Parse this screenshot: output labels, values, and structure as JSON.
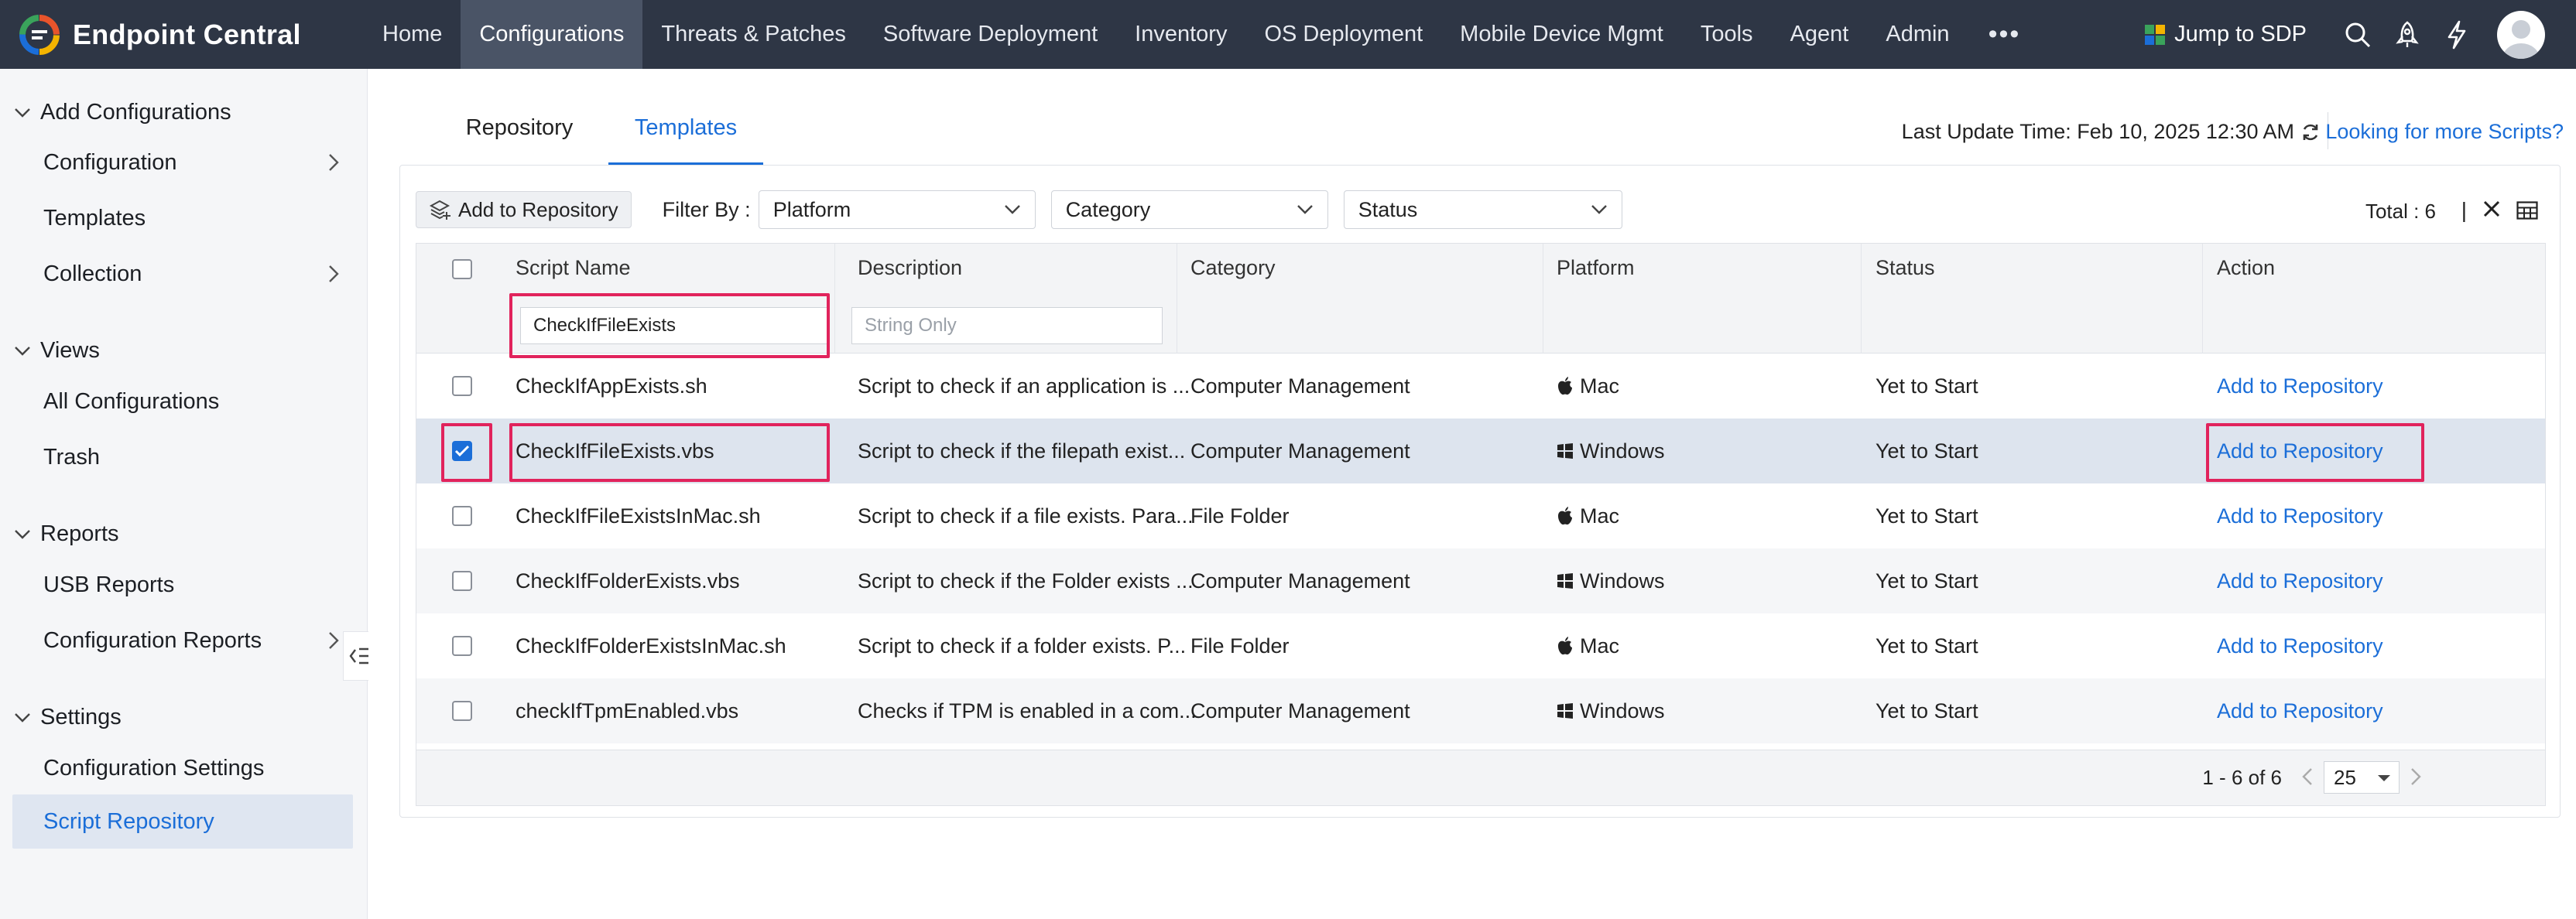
{
  "brand": {
    "name": "Endpoint Central"
  },
  "nav": {
    "items": [
      "Home",
      "Configurations",
      "Threats & Patches",
      "Software Deployment",
      "Inventory",
      "OS Deployment",
      "Mobile Device Mgmt",
      "Tools",
      "Agent",
      "Admin"
    ],
    "active": "Configurations",
    "more": "•••",
    "jump": "Jump to SDP"
  },
  "sidebar": {
    "add_configurations": "Add Configurations",
    "configuration": "Configuration",
    "templates": "Templates",
    "collection": "Collection",
    "views": "Views",
    "all_configurations": "All Configurations",
    "trash": "Trash",
    "reports": "Reports",
    "usb_reports": "USB Reports",
    "configuration_reports": "Configuration Reports",
    "settings": "Settings",
    "configuration_settings": "Configuration Settings",
    "script_repository": "Script Repository"
  },
  "tabs": {
    "repository": "Repository",
    "templates": "Templates",
    "active": "Templates"
  },
  "last_update": "Last Update Time: Feb 10, 2025 12:30 AM",
  "more_scripts": "Looking for more Scripts?",
  "toolbar": {
    "add_to_repository": "Add to Repository",
    "filter_by": "Filter By :",
    "platform": "Platform",
    "category": "Category",
    "status": "Status",
    "total": "Total : 6",
    "separator": "|"
  },
  "table": {
    "columns": [
      "Script Name",
      "Description",
      "Category",
      "Platform",
      "Status",
      "Action"
    ],
    "script_filter_value": "CheckIfFileExists",
    "description_placeholder": "String Only",
    "rows": [
      {
        "name": "CheckIfAppExists.sh",
        "description": "Script to check if an application is ...",
        "category": "Computer Management",
        "platform": "Mac",
        "platform_icon": "apple-icon",
        "status": "Yet to Start",
        "action": "Add to Repository",
        "checked": false
      },
      {
        "name": "CheckIfFileExists.vbs",
        "description": "Script to check if the filepath exist...",
        "category": "Computer Management",
        "platform": "Windows",
        "platform_icon": "windows-icon",
        "status": "Yet to Start",
        "action": "Add to Repository",
        "checked": true
      },
      {
        "name": "CheckIfFileExistsInMac.sh",
        "description": "Script to check if a file exists. Para...",
        "category": "File Folder",
        "platform": "Mac",
        "platform_icon": "apple-icon",
        "status": "Yet to Start",
        "action": "Add to Repository",
        "checked": false
      },
      {
        "name": "CheckIfFolderExists.vbs",
        "description": "Script to check if the Folder exists ...",
        "category": "Computer Management",
        "platform": "Windows",
        "platform_icon": "windows-icon",
        "status": "Yet to Start",
        "action": "Add to Repository",
        "checked": false
      },
      {
        "name": "CheckIfFolderExistsInMac.sh",
        "description": "Script to check if a folder exists. P...",
        "category": "File Folder",
        "platform": "Mac",
        "platform_icon": "apple-icon",
        "status": "Yet to Start",
        "action": "Add to Repository",
        "checked": false
      },
      {
        "name": "checkIfTpmEnabled.vbs",
        "description": "Checks if TPM is enabled in a com...",
        "category": "Computer Management",
        "platform": "Windows",
        "platform_icon": "windows-icon",
        "status": "Yet to Start",
        "action": "Add to Repository",
        "checked": false
      }
    ]
  },
  "pagination": {
    "range": "1 - 6 of 6",
    "page_size": "25"
  },
  "colors": {
    "nav_bg": "#2e3645",
    "accent": "#1b6ed8",
    "highlight": "#e1235c",
    "selected_row": "#dde4ee"
  }
}
